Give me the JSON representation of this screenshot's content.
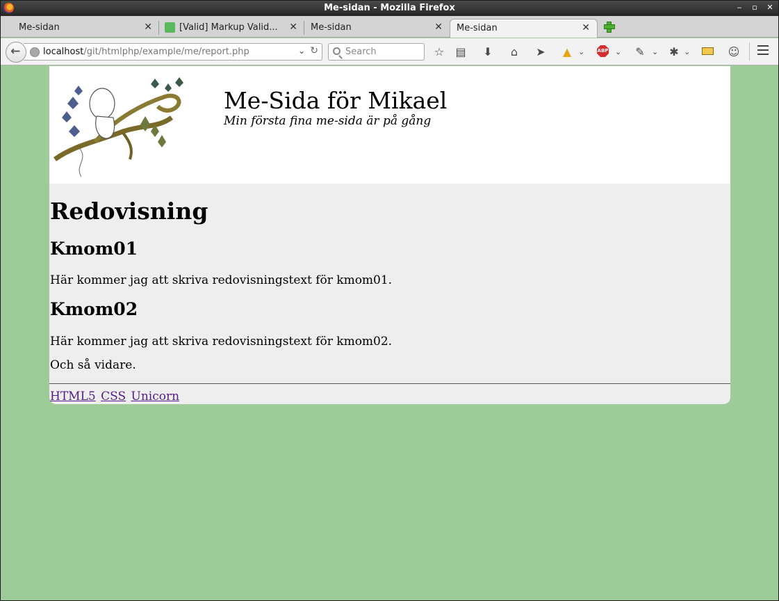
{
  "window": {
    "title": "Me-sidan - Mozilla Firefox"
  },
  "tabs": [
    {
      "label": "Me-sidan",
      "active": false
    },
    {
      "label": "[Valid] Markup Valid...",
      "active": false
    },
    {
      "label": "Me-sidan",
      "active": false
    },
    {
      "label": "Me-sidan",
      "active": true
    }
  ],
  "navbar": {
    "url_host": "localhost",
    "url_path": "/git/htmlphp/example/me/report.php",
    "search_placeholder": "Search"
  },
  "icons": {
    "back": "back-arrow-icon",
    "bookmark": "star-icon",
    "reading": "clipboard-icon",
    "download": "download-arrow-icon",
    "home": "home-icon",
    "send": "paper-plane-icon",
    "addon1": "colorful-triangle-icon",
    "adblock": "abp-stop-icon",
    "eyedropper": "eyedropper-icon",
    "bug": "bug-icon",
    "ruler": "ruler-icon",
    "emoji": "smiley-icon",
    "menu": "hamburger-menu-icon"
  },
  "adblock_label": "ABP",
  "page": {
    "site_title": "Me-Sida för Mikael",
    "site_slogan": "Min första fina me-sida är på gång",
    "h1": "Redovisning",
    "sections": [
      {
        "heading": "Kmom01",
        "text": "Här kommer jag att skriva redovisningstext för kmom01."
      },
      {
        "heading": "Kmom02",
        "text": "Här kommer jag att skriva redovisningstext för kmom02."
      }
    ],
    "closing_text": "Och så vidare.",
    "footer_links": [
      "HTML5",
      "CSS",
      "Unicorn"
    ]
  },
  "colors": {
    "page_background": "#9dcc98",
    "content_background": "#eeeeee",
    "link_visited": "#551a8b"
  }
}
